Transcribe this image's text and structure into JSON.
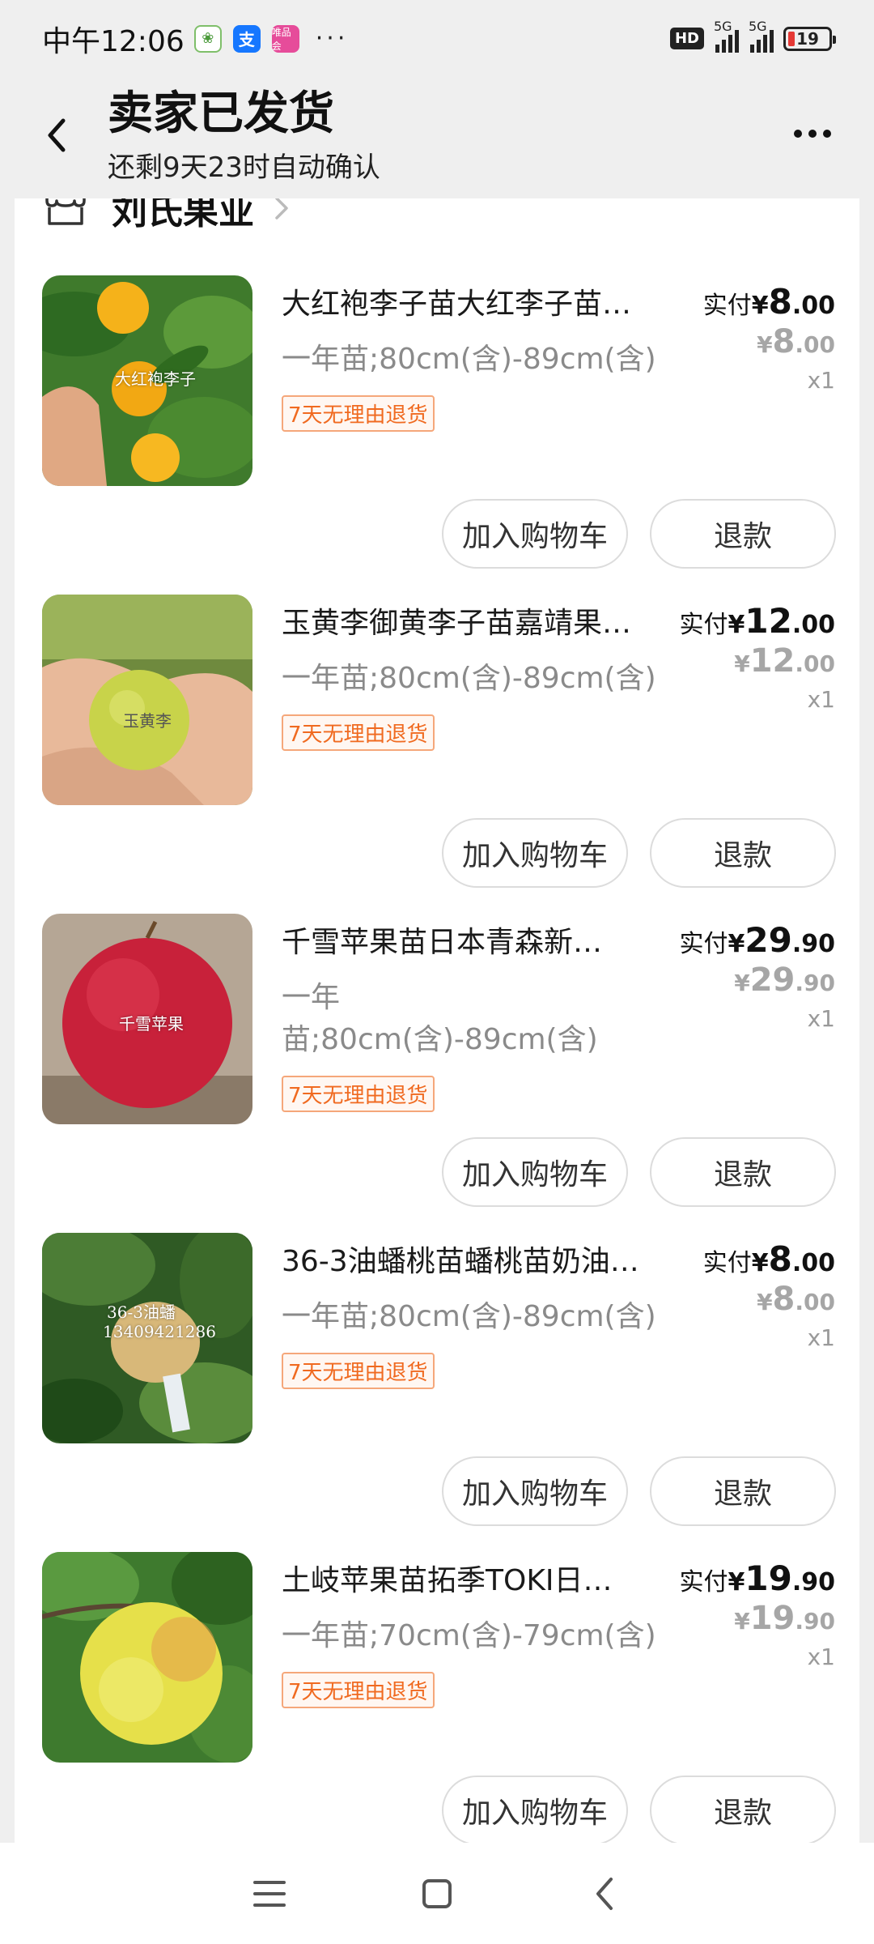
{
  "status_bar": {
    "time": "中午12:06",
    "app_vip_label": "唯品会",
    "more": "···",
    "hd": "HD",
    "net1": "5G",
    "net2": "5G",
    "battery": "19"
  },
  "header": {
    "title": "卖家已发货",
    "subtitle": "还剩9天23时自动确认"
  },
  "shop": {
    "name": "刘氏果业"
  },
  "common": {
    "paid_label": "实付",
    "cart_button": "加入购物车",
    "refund_button": "退款",
    "return_tag": "7天无理由退货",
    "yen": "¥"
  },
  "items": [
    {
      "title": "大红袍李子苗大红李子苗…",
      "spec": "一年苗;80cm(含)-89cm(含)",
      "price_int": "8",
      "price_dec": ".00",
      "orig_int": "8",
      "orig_dec": ".00",
      "qty": "x1",
      "thumb_text": "大红袍李子"
    },
    {
      "title": "玉黄李御黄李子苗嘉靖果…",
      "spec": "一年苗;80cm(含)-89cm(含)",
      "price_int": "12",
      "price_dec": ".00",
      "orig_int": "12",
      "orig_dec": ".00",
      "qty": "x1",
      "thumb_text": "玉黄李"
    },
    {
      "title": "千雪苹果苗日本青森新…",
      "spec_line1": "一年",
      "spec_line2": "苗;80cm(含)-89cm(含)",
      "price_int": "29",
      "price_dec": ".90",
      "orig_int": "29",
      "orig_dec": ".90",
      "qty": "x1",
      "thumb_text": "千雪苹果"
    },
    {
      "title": "36-3油蟠桃苗蟠桃苗奶油…",
      "spec": "一年苗;80cm(含)-89cm(含)",
      "price_int": "8",
      "price_dec": ".00",
      "orig_int": "8",
      "orig_dec": ".00",
      "qty": "x1",
      "thumb_text_1": "36-3油蟠",
      "thumb_text_2": "13409421286"
    },
    {
      "title": "土岐苹果苗拓季TOKI日…",
      "spec": "一年苗;70cm(含)-79cm(含)",
      "price_int": "19",
      "price_dec": ".90",
      "orig_int": "19",
      "orig_dec": ".90",
      "qty": "x1"
    }
  ],
  "colors": {
    "tag_orange": "#f06a20",
    "page_bg": "#efefef",
    "alipay_blue": "#1677ff"
  }
}
